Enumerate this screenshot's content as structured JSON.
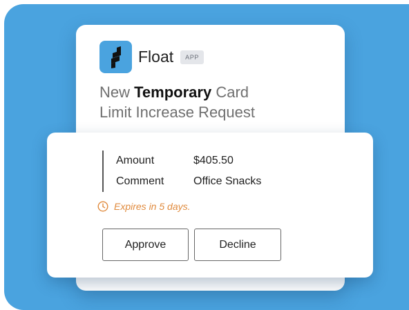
{
  "brand": {
    "name": "Float",
    "badge": "APP",
    "accent_color": "#4aa3df",
    "logo_icon": "float-logo-icon"
  },
  "request": {
    "title_prefix": "New ",
    "title_emphasis": "Temporary",
    "title_suffix": " Card",
    "title_line2": "Limit Increase Request"
  },
  "details": [
    {
      "label": "Amount",
      "value": "$405.50"
    },
    {
      "label": "Comment",
      "value": "Office Snacks"
    }
  ],
  "expiry": {
    "text": "Expires in 5 days.",
    "icon": "clock-icon",
    "color": "#e08a3c"
  },
  "actions": {
    "approve_label": "Approve",
    "decline_label": "Decline"
  }
}
